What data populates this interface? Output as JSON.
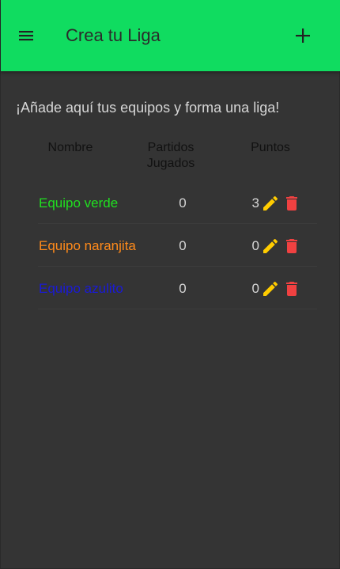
{
  "header": {
    "title": "Crea tu Liga",
    "menu_icon": "menu-icon",
    "add_icon": "plus-icon"
  },
  "intro_text": "¡Añade aquí tus equipos y forma una liga!",
  "table": {
    "headers": {
      "name": "Nombre",
      "played": "Partidos Jugados",
      "points": "Puntos"
    },
    "rows": [
      {
        "name": "Equipo verde",
        "color": "#20e020",
        "played": "0",
        "points": "3"
      },
      {
        "name": "Equipo naranjita",
        "color": "#ff8a1a",
        "played": "0",
        "points": "0"
      },
      {
        "name": "Equipo azulito",
        "color": "#1a1ad6",
        "played": "0",
        "points": "0"
      }
    ],
    "edit_icon": "pencil-icon",
    "delete_icon": "trash-icon"
  },
  "colors": {
    "appbar": "#10dc60",
    "background": "#343434",
    "edit_icon": "#ffcc00",
    "delete_icon": "#f04141"
  }
}
